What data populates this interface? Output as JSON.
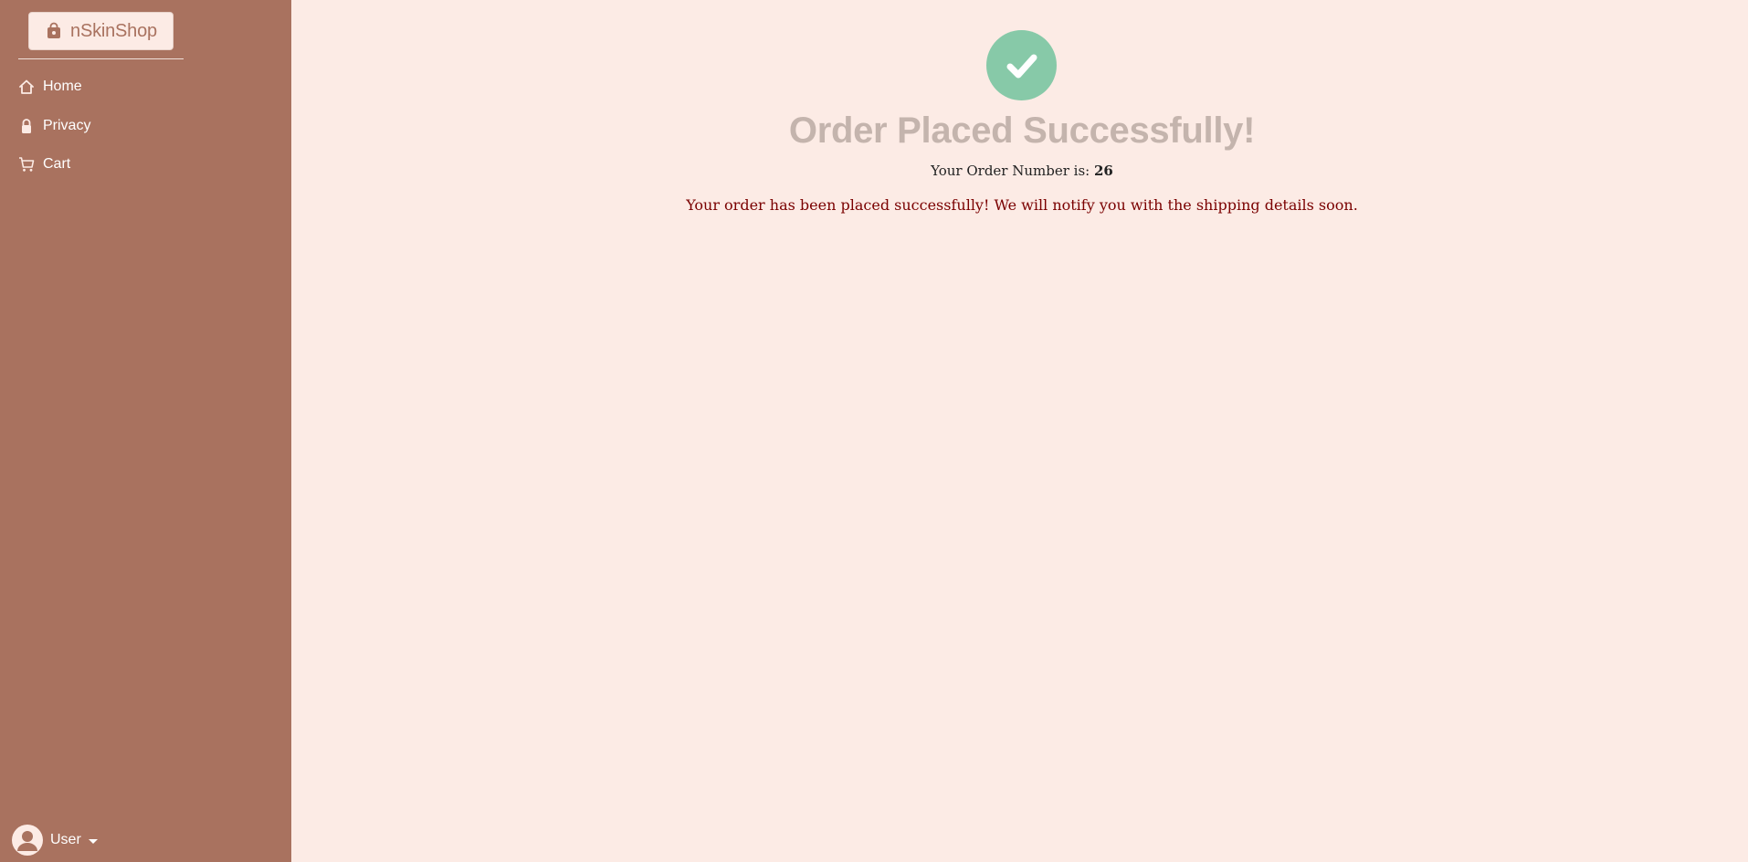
{
  "sidebar": {
    "brand": {
      "label": "nSkinShop",
      "icon": "shopping-bag-icon"
    },
    "items": [
      {
        "label": "Home",
        "icon": "home-icon"
      },
      {
        "label": "Privacy",
        "icon": "lock-icon"
      },
      {
        "label": "Cart",
        "icon": "cart-icon"
      }
    ],
    "user": {
      "label": "User",
      "icon": "user-avatar-icon"
    }
  },
  "main": {
    "status_icon": "check-circle-icon",
    "title": "Order Placed Successfully!",
    "order_number_prefix": "Your Order Number is:",
    "order_number": "26",
    "message": "Your order has been placed successfully! We will notify you with the shipping details soon."
  },
  "colors": {
    "sidebar": "#a9725f",
    "background": "#fcebe5",
    "success": "#87c9a8",
    "title": "#c4b4ad",
    "message": "#7a0000"
  }
}
